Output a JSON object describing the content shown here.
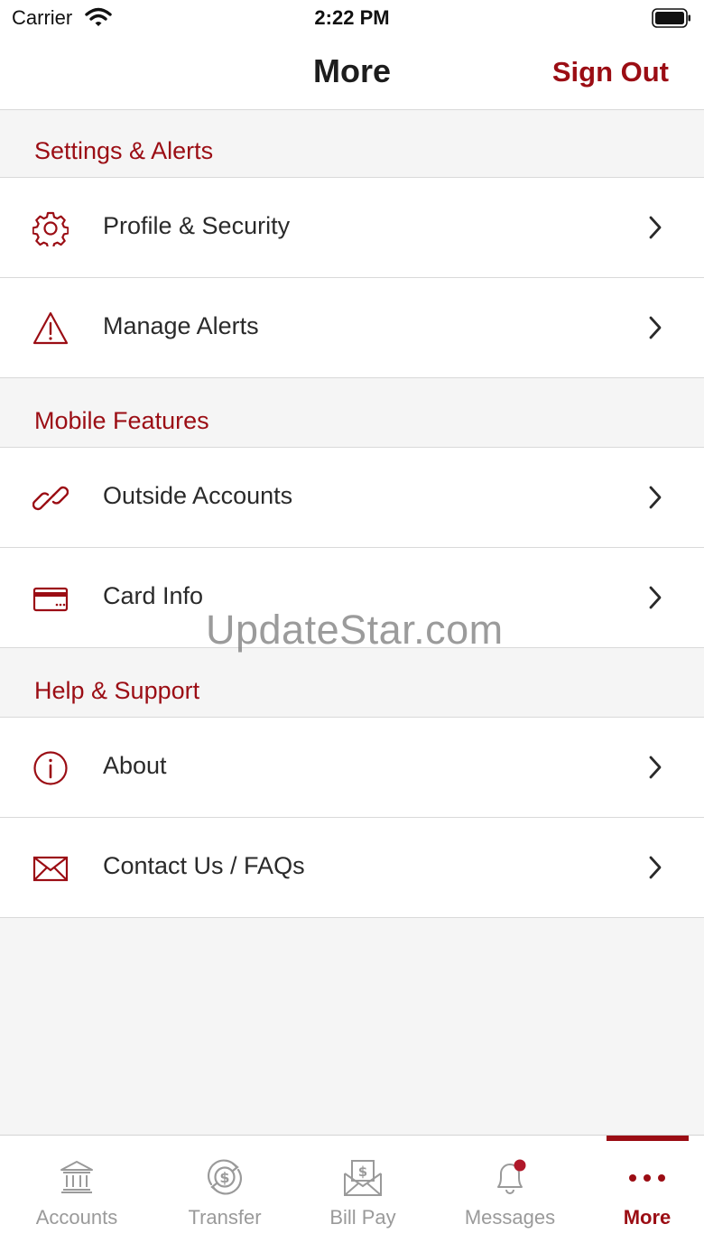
{
  "status_bar": {
    "carrier": "Carrier",
    "time": "2:22 PM"
  },
  "header": {
    "title": "More",
    "sign_out_label": "Sign Out"
  },
  "sections": [
    {
      "title": "Settings & Alerts",
      "items": [
        {
          "label": "Profile & Security",
          "icon": "gear-icon"
        },
        {
          "label": "Manage Alerts",
          "icon": "warning-icon"
        }
      ]
    },
    {
      "title": "Mobile Features",
      "items": [
        {
          "label": "Outside Accounts",
          "icon": "link-icon"
        },
        {
          "label": "Card Info",
          "icon": "credit-card-icon"
        }
      ]
    },
    {
      "title": "Help & Support",
      "items": [
        {
          "label": "About",
          "icon": "info-icon"
        },
        {
          "label": "Contact Us / FAQs",
          "icon": "envelope-icon"
        }
      ]
    }
  ],
  "watermark": "UpdateStar.com",
  "tabs": [
    {
      "label": "Accounts",
      "icon": "bank-icon"
    },
    {
      "label": "Transfer",
      "icon": "transfer-icon"
    },
    {
      "label": "Bill Pay",
      "icon": "bill-envelope-icon"
    },
    {
      "label": "Messages",
      "icon": "bell-icon",
      "has_badge": true
    },
    {
      "label": "More",
      "icon": "more-dots-icon",
      "active": true
    }
  ],
  "colors": {
    "accent": "#9b0d14",
    "inactive": "#9a9a9a",
    "background": "#f5f5f5"
  }
}
